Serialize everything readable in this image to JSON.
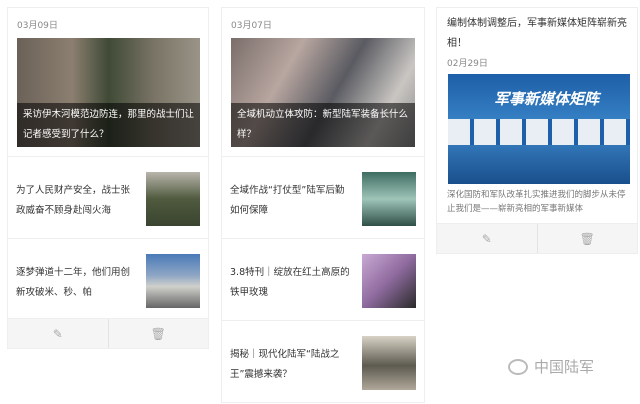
{
  "columns": [
    {
      "date": "03月09日",
      "cover_title": "采访伊木河模范边防连，那里的战士们让记者感受到了什么？",
      "items": [
        "为了人民财产安全，战士张政威奋不顾身赴闯火海",
        "逐梦弹道十二年，他们用创新攻破米、秒、帕"
      ]
    },
    {
      "date": "03月07日",
      "cover_title": "全域机动立体攻防：新型陆军装备长什么样？",
      "items": [
        "全域作战“打仗型”陆军后勤如何保障",
        "3.8特刊｜绽放在红土高原的铁甲玫瑰",
        "揭秘｜现代化陆军“陆战之王”震撼来袭？"
      ]
    },
    {
      "title": "编制体制调整后，军事新媒体矩阵崭新亮相！",
      "date": "02月29日",
      "banner_text": "军事新媒体矩阵",
      "summary": "深化国防和军队改革扎实推进我们的脚步从未停止我们是——崭新亮相的军事新媒体"
    }
  ],
  "actions": {
    "edit_icon": "✎",
    "delete_icon": "🗑"
  },
  "watermark": "中国陆军"
}
